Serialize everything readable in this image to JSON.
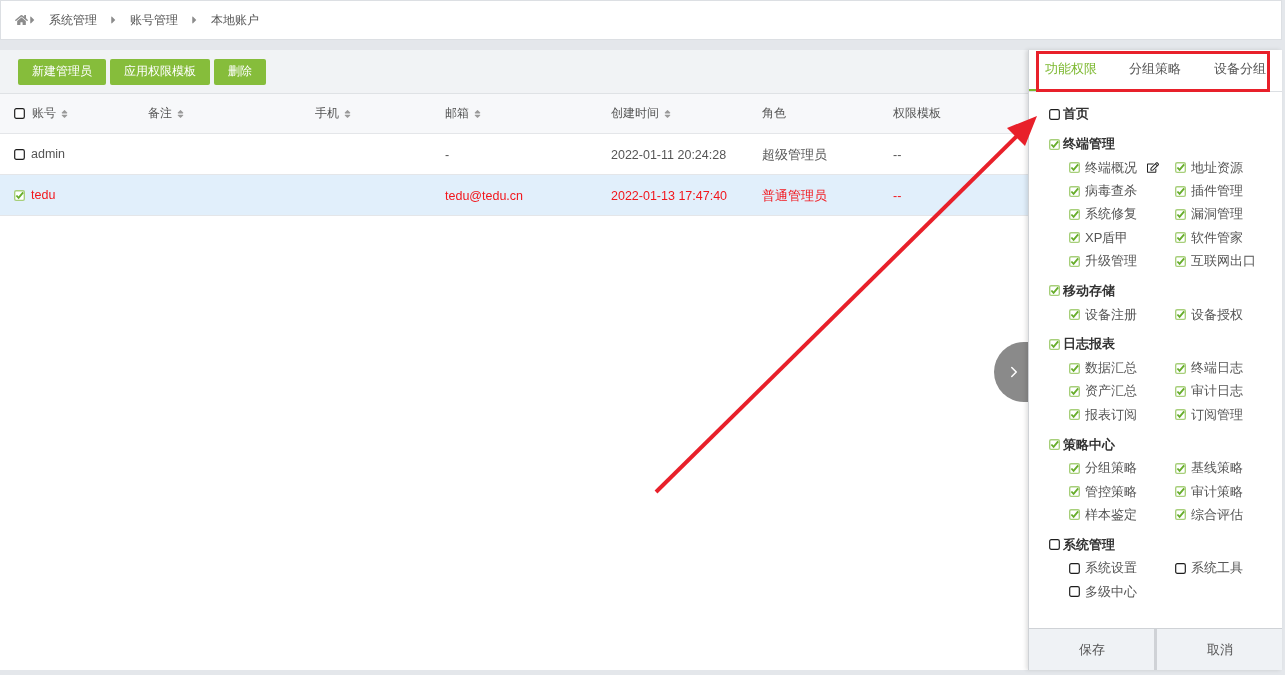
{
  "breadcrumb": {
    "items": [
      "系统管理",
      "账号管理",
      "本地账户"
    ]
  },
  "toolbar": {
    "buttons": [
      "新建管理员",
      "应用权限模板",
      "删除"
    ]
  },
  "table": {
    "select_all_checked": false,
    "columns": [
      {
        "label": "账号",
        "sortable": true
      },
      {
        "label": "备注",
        "sortable": true
      },
      {
        "label": "手机",
        "sortable": true
      },
      {
        "label": "邮箱",
        "sortable": true
      },
      {
        "label": "创建时间",
        "sortable": true
      },
      {
        "label": "角色",
        "sortable": false
      },
      {
        "label": "权限模板",
        "sortable": false
      }
    ],
    "rows": [
      {
        "selected": false,
        "checked": false,
        "account": "admin",
        "email": "-",
        "created": "2022-01-11 20:24:28",
        "role": "超级管理员",
        "template": "--"
      },
      {
        "selected": true,
        "checked": true,
        "account": "tedu",
        "email": "tedu@tedu.cn",
        "created": "2022-01-13 17:47:40",
        "role": "普通管理员",
        "template": "--"
      }
    ]
  },
  "panel": {
    "tabs": [
      {
        "label": "功能权限",
        "selected": true
      },
      {
        "label": "分组策略",
        "selected": false
      },
      {
        "label": "设备分组",
        "selected": false
      }
    ],
    "permissions": [
      {
        "label": "首页",
        "checked": false
      },
      {
        "label": "终端管理",
        "checked": true,
        "children": [
          {
            "label": "终端概况",
            "checked": true,
            "edit": true
          },
          {
            "label": "地址资源",
            "checked": true,
            "edit": false
          },
          {
            "label": "病毒查杀",
            "checked": true,
            "edit": false
          },
          {
            "label": "插件管理",
            "checked": true,
            "edit": false
          },
          {
            "label": "系统修复",
            "checked": true,
            "edit": false
          },
          {
            "label": "漏洞管理",
            "checked": true,
            "edit": false
          },
          {
            "label": "XP盾甲",
            "checked": true,
            "edit": false
          },
          {
            "label": "软件管家",
            "checked": true,
            "edit": false
          },
          {
            "label": "升级管理",
            "checked": true,
            "edit": false
          },
          {
            "label": "互联网出口",
            "checked": true,
            "edit": false
          }
        ]
      },
      {
        "label": "移动存储",
        "checked": true,
        "children": [
          {
            "label": "设备注册",
            "checked": true,
            "edit": false
          },
          {
            "label": "设备授权",
            "checked": true,
            "edit": false
          }
        ]
      },
      {
        "label": "日志报表",
        "checked": true,
        "children": [
          {
            "label": "数据汇总",
            "checked": true,
            "edit": false
          },
          {
            "label": "终端日志",
            "checked": true,
            "edit": false
          },
          {
            "label": "资产汇总",
            "checked": true,
            "edit": false
          },
          {
            "label": "审计日志",
            "checked": true,
            "edit": false
          },
          {
            "label": "报表订阅",
            "checked": true,
            "edit": false
          },
          {
            "label": "订阅管理",
            "checked": true,
            "edit": false
          }
        ]
      },
      {
        "label": "策略中心",
        "checked": true,
        "children": [
          {
            "label": "分组策略",
            "checked": true,
            "edit": false
          },
          {
            "label": "基线策略",
            "checked": true,
            "edit": false
          },
          {
            "label": "管控策略",
            "checked": true,
            "edit": false
          },
          {
            "label": "审计策略",
            "checked": true,
            "edit": false
          },
          {
            "label": "样本鉴定",
            "checked": true,
            "edit": false
          },
          {
            "label": "综合评估",
            "checked": true,
            "edit": false
          }
        ]
      },
      {
        "label": "系统管理",
        "checked": false,
        "children": [
          {
            "label": "系统设置",
            "checked": false,
            "edit": false
          },
          {
            "label": "系统工具",
            "checked": false,
            "edit": false
          },
          {
            "label": "多级中心",
            "checked": false,
            "edit": false
          }
        ]
      }
    ],
    "buttons": [
      "保存",
      "取消"
    ]
  }
}
